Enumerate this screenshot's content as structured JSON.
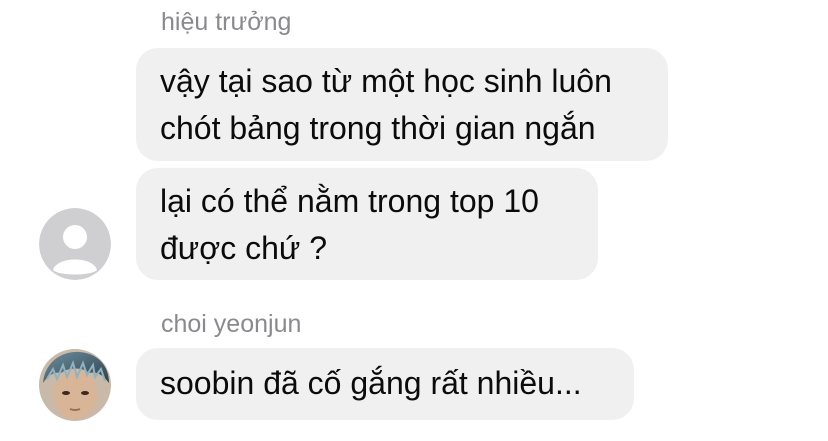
{
  "thread": {
    "group1": {
      "sender": "hiệu trưởng",
      "messages": [
        {
          "lines": [
            "vậy tại sao từ một học sinh luôn",
            "chót bảng trong thời gian ngắn"
          ]
        },
        {
          "lines": [
            "lại có thể nằm trong top 10",
            "được chứ ?"
          ]
        }
      ],
      "avatar": "default-person-icon"
    },
    "group2": {
      "sender": "choi yeonjun",
      "messages": [
        {
          "lines": [
            "soobin đã cố gắng rất nhiều..."
          ]
        }
      ],
      "avatar": "profile-photo"
    }
  },
  "colors": {
    "bubble": "#f0f0f0",
    "sender_text": "#8a8a8e",
    "message_text": "#0b0b0b",
    "default_avatar_bg": "#cfcfd2"
  }
}
